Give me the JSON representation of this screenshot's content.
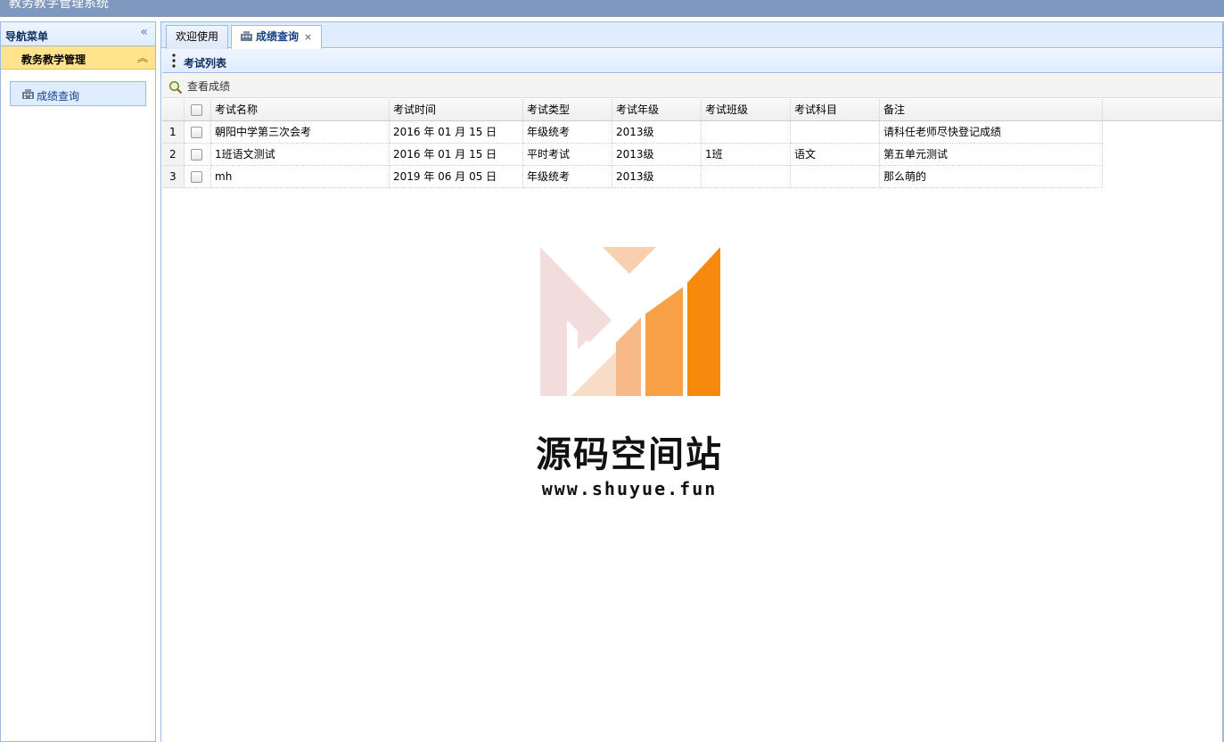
{
  "app": {
    "title": "教务教学管理系统"
  },
  "nav": {
    "title": "导航菜单",
    "section": "教务教学管理",
    "items": [
      {
        "label": "成绩查询",
        "icon": "building-icon"
      }
    ]
  },
  "tabs": [
    {
      "label": "欢迎使用",
      "active": false
    },
    {
      "label": "成绩查询",
      "active": true,
      "closable": true,
      "close_label": "×"
    }
  ],
  "panel": {
    "title": "考试列表"
  },
  "toolbar": {
    "view_scores_label": "查看成绩"
  },
  "grid": {
    "columns": [
      "考试名称",
      "考试时间",
      "考试类型",
      "考试年级",
      "考试班级",
      "考试科目",
      "备注"
    ],
    "rows": [
      {
        "num": "1",
        "name": "朝阳中学第三次会考",
        "time": "2016 年 01 月 15 日",
        "type": "年级统考",
        "grade": "2013级",
        "class": "",
        "subject": "",
        "note": "请科任老师尽快登记成绩"
      },
      {
        "num": "2",
        "name": "1班语文测试",
        "time": "2016 年 01 月 15 日",
        "type": "平时考试",
        "grade": "2013级",
        "class": "1班",
        "subject": "语文",
        "note": "第五单元测试"
      },
      {
        "num": "3",
        "name": "mh",
        "time": "2019 年 06 月 05 日",
        "type": "年级统考",
        "grade": "2013级",
        "class": "",
        "subject": "",
        "note": "那么萌的"
      }
    ]
  },
  "watermark": {
    "title": "源码空间站",
    "url": "www.shuyue.fun"
  },
  "colors": {
    "header_blue": "#7f99be",
    "border_blue": "#99bbe8",
    "accordion_yellow": "#ffe48d",
    "logo_orange": "#f7890c"
  }
}
